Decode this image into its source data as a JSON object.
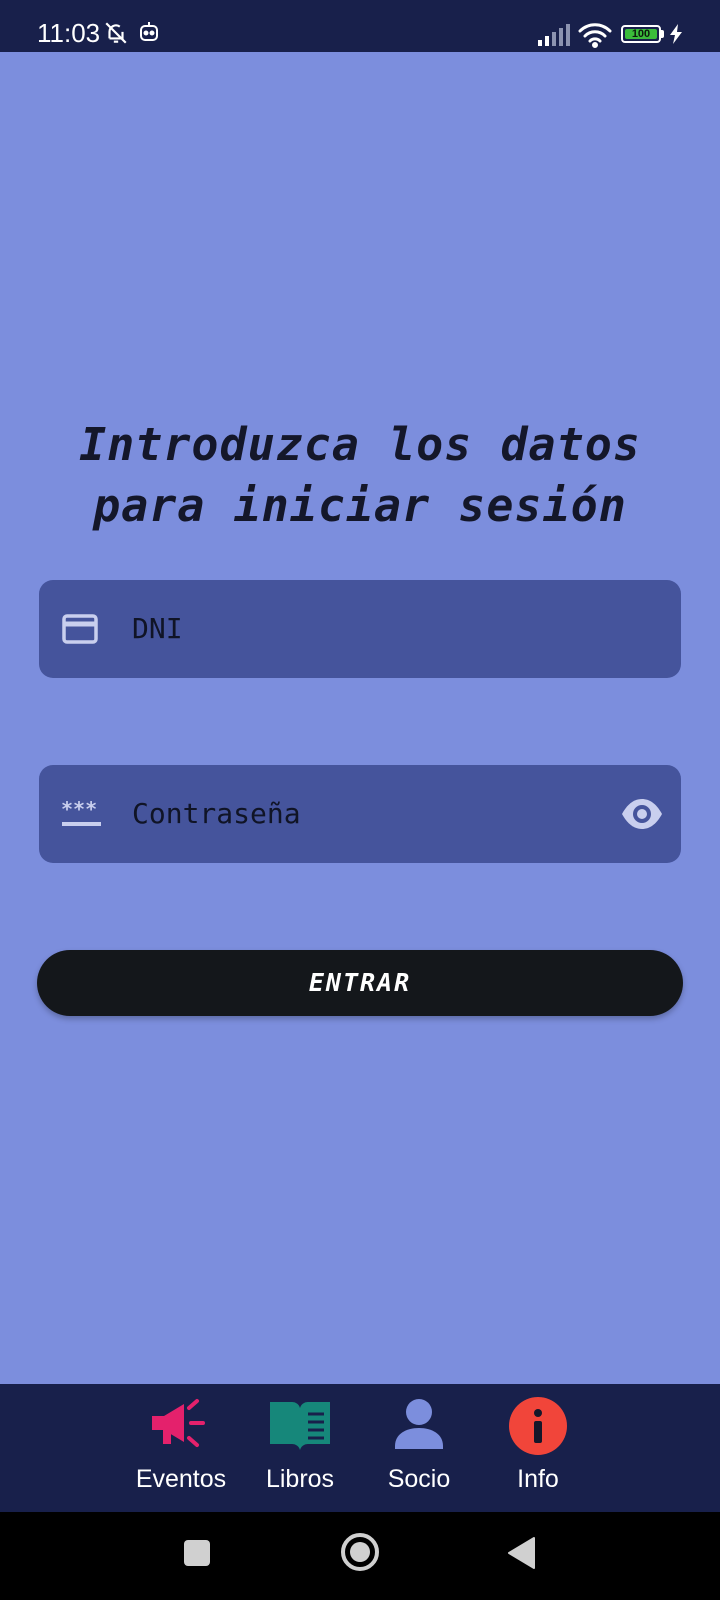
{
  "status_bar": {
    "time": "11:03",
    "battery": "100",
    "icons": [
      "bell-off-icon",
      "robot-icon",
      "signal-icon",
      "wifi-icon",
      "battery-icon",
      "charging-bolt-icon"
    ],
    "battery_color": "#3bbc3b"
  },
  "login": {
    "heading_line1": "Introduzca los datos",
    "heading_line2": "para iniciar sesión",
    "dni_placeholder": "DNI",
    "password_placeholder": "Contraseña",
    "enter_label": "ENTRAR"
  },
  "bottom_nav": {
    "items": [
      {
        "label": "Eventos",
        "icon": "megaphone-icon",
        "color": "#e4216c"
      },
      {
        "label": "Libros",
        "icon": "book-icon",
        "color": "#16877a"
      },
      {
        "label": "Socio",
        "icon": "person-icon",
        "color": "#7c8edd"
      },
      {
        "label": "Info",
        "icon": "info-icon",
        "color": "#f1453a"
      }
    ]
  },
  "system_nav": {
    "buttons": [
      "recents-square-icon",
      "home-circle-icon",
      "back-triangle-icon"
    ]
  },
  "colors": {
    "background": "#7c8edd",
    "field": "#45549c",
    "bar": "#18204b",
    "button": "#14171b"
  }
}
